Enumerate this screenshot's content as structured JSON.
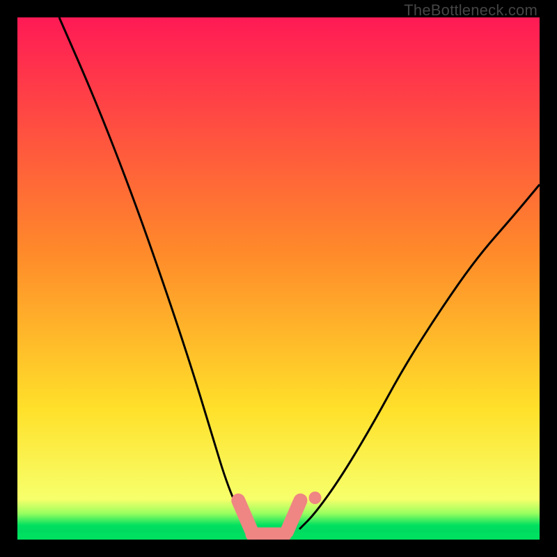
{
  "watermark": "TheBottleneck.com",
  "colors": {
    "frame": "#000000",
    "gradient_top": "#ff1a55",
    "gradient_mid1": "#ff8a2a",
    "gradient_mid2": "#ffe02a",
    "gradient_bottom": "#f7ff6a",
    "green_band_start": "#9cff60",
    "green_band_end": "#00e060",
    "curve": "#000000",
    "marker": "#ef8683"
  },
  "chart_data": {
    "type": "line",
    "title": "",
    "xlabel": "",
    "ylabel": "",
    "xlim": [
      0,
      100
    ],
    "ylim": [
      0,
      100
    ],
    "grid": false,
    "series": [
      {
        "name": "left-curve",
        "x": [
          8,
          15,
          22,
          28,
          33,
          37,
          40,
          43,
          44.5
        ],
        "values": [
          100,
          84,
          66,
          49,
          34,
          21,
          11,
          4,
          1
        ]
      },
      {
        "name": "right-curve",
        "x": [
          54,
          57,
          62,
          68,
          74,
          81,
          88,
          95,
          100
        ],
        "values": [
          2,
          5,
          12,
          22,
          33,
          44,
          54,
          62,
          68
        ]
      }
    ],
    "markers": [
      {
        "name": "left-bar-segment",
        "x": 43.5,
        "y": 4
      },
      {
        "name": "floor-segment",
        "x": 48.0,
        "y": 1
      },
      {
        "name": "right-bar-segment",
        "x": 53.0,
        "y": 4
      },
      {
        "name": "outlier-dot",
        "x": 57.0,
        "y": 8
      }
    ],
    "legend": false
  }
}
